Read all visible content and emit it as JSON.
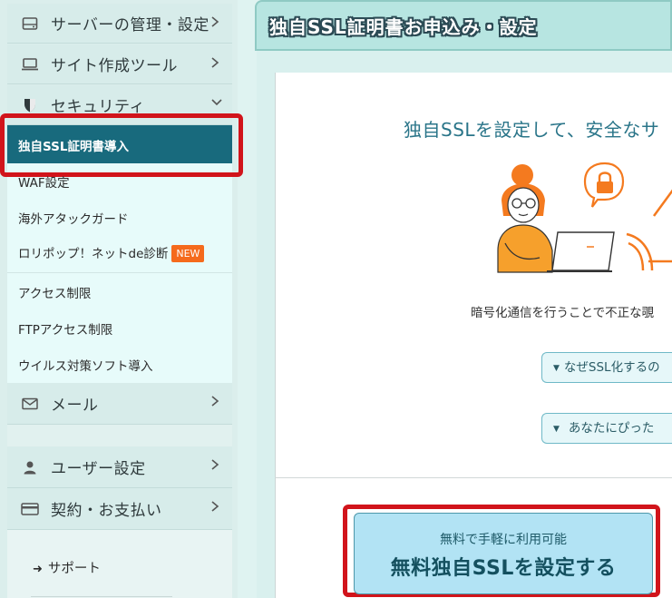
{
  "sidebar": {
    "main_items": [
      {
        "label": "サーバーの管理・設定",
        "icon": "server-icon"
      },
      {
        "label": "サイト作成ツール",
        "icon": "laptop-icon"
      },
      {
        "label": "セキュリティ",
        "icon": "shield-icon"
      },
      {
        "label": "メール",
        "icon": "mail-icon"
      },
      {
        "label": "ユーザー設定",
        "icon": "user-icon"
      },
      {
        "label": "契約・お支払い",
        "icon": "credit-card-icon"
      }
    ],
    "security_sub": [
      {
        "label": "独自SSL証明書導入"
      },
      {
        "label": "WAF設定"
      },
      {
        "label": "海外アタックガード"
      },
      {
        "label": "ロリポップ！ネットde診断",
        "badge": "NEW"
      },
      {
        "label": "アクセス制限"
      },
      {
        "label": "FTPアクセス制限"
      },
      {
        "label": "ウイルス対策ソフト導入"
      }
    ],
    "support": "サポート"
  },
  "main": {
    "title": "独自SSL証明書お申込み・設定",
    "headline": "独自SSLを設定して、安全なサ",
    "description": "暗号化通信を行うことで不正な覗",
    "pills": [
      {
        "label": "なぜSSL化するの"
      },
      {
        "label": "あなたにぴった"
      }
    ],
    "cta": {
      "sub": "無料で手軽に利用可能",
      "main": "無料独自SSLを設定する"
    }
  },
  "colors": {
    "active_item_bg": "#186a7d",
    "highlight_red": "#d1141b",
    "badge_orange": "#f56a1c",
    "cta_bg": "#b2e3f4",
    "headline_teal": "#2a7589"
  }
}
